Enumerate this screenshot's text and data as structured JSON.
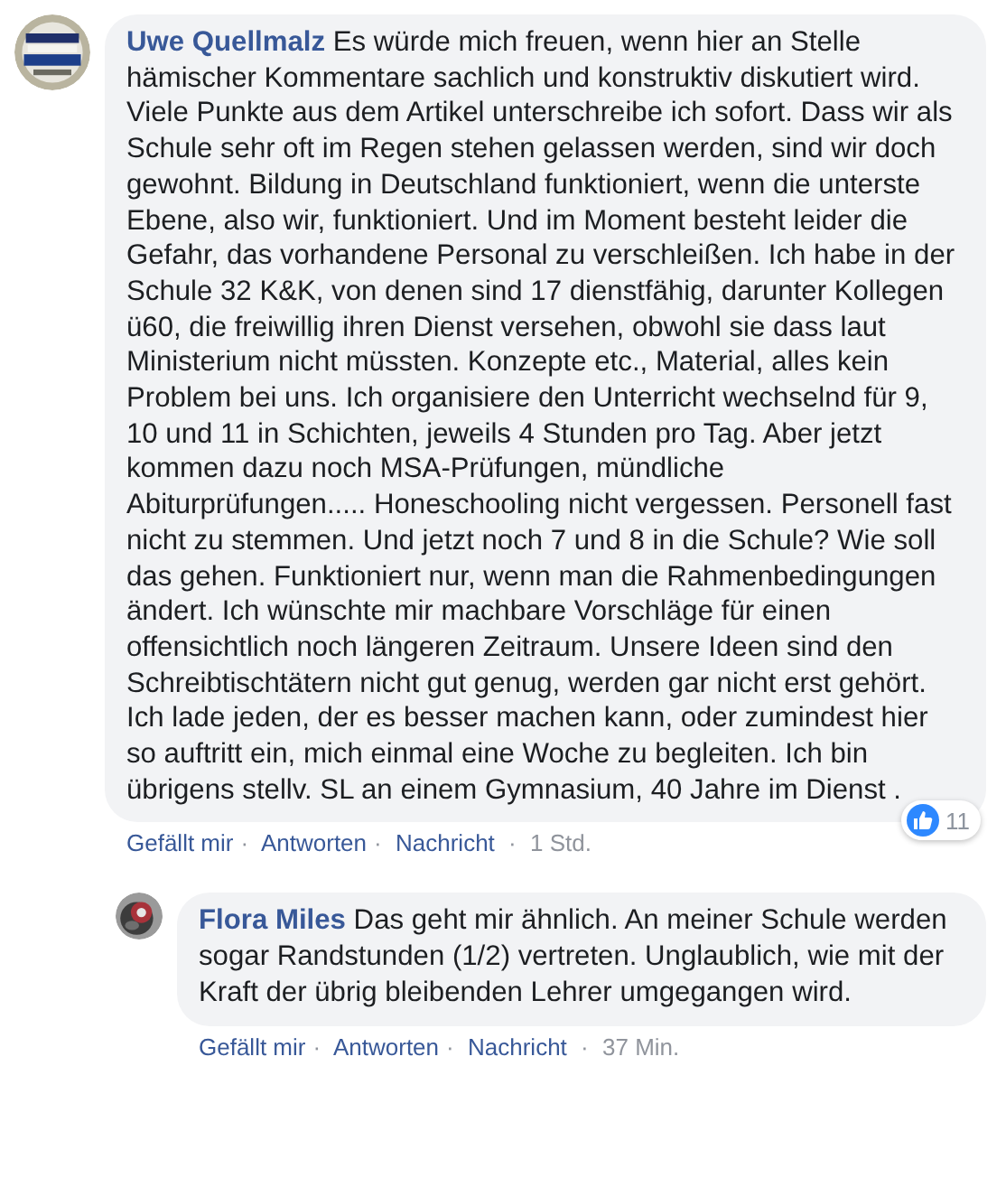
{
  "separator": "·",
  "comments": [
    {
      "author": "Uwe Quellmalz",
      "text": "Es würde mich freuen, wenn hier an Stelle hämischer Kommentare sachlich und konstruktiv diskutiert wird. Viele Punkte aus dem Artikel unterschreibe ich sofort. Dass wir als Schule sehr oft im Regen stehen gelassen werden, sind wir doch gewohnt. Bildung in Deutschland funktioniert, wenn die unterste Ebene, also wir, funktioniert. Und im Moment besteht leider die Gefahr, das vorhandene Personal zu verschleißen. Ich habe in der Schule 32 K&K, von denen sind 17 dienstfähig, darunter Kollegen ü60, die freiwillig ihren Dienst versehen, obwohl sie dass laut Ministerium nicht müssten. Konzepte etc., Material, alles kein Problem bei uns. Ich organisiere den Unterricht wechselnd für 9, 10 und 11 in Schichten, jeweils 4 Stunden pro Tag. Aber jetzt kommen dazu noch MSA-Prüfungen, mündliche Abiturprüfungen..... Honeschooling nicht vergessen. Personell fast nicht zu stemmen. Und jetzt noch 7 und 8 in die Schule? Wie soll das gehen. Funktioniert nur, wenn man die Rahmenbedingungen ändert. Ich wünschte mir machbare Vorschläge für einen offensichtlich noch längeren Zeitraum. Unsere Ideen sind den Schreibtischtätern nicht gut genug, werden gar nicht erst gehört. Ich lade jeden, der es besser machen kann, oder zumindest hier so auftritt ein, mich einmal eine Woche zu begleiten. Ich bin übrigens stellv. SL an einem Gymnasium, 40 Jahre im Dienst .",
      "actions": [
        "Gefällt mir",
        "Antworten",
        "Nachricht"
      ],
      "time": "1 Std.",
      "reactions": {
        "count": "11"
      },
      "replies": [
        {
          "author": "Flora Miles",
          "text": "Das geht mir ähnlich. An meiner Schule werden sogar Randstunden (1/2) vertreten. Unglaublich, wie mit der Kraft der übrig bleibenden Lehrer umgegangen wird.",
          "actions": [
            "Gefällt mir",
            "Antworten",
            "Nachricht"
          ],
          "time": "37 Min."
        }
      ]
    }
  ]
}
